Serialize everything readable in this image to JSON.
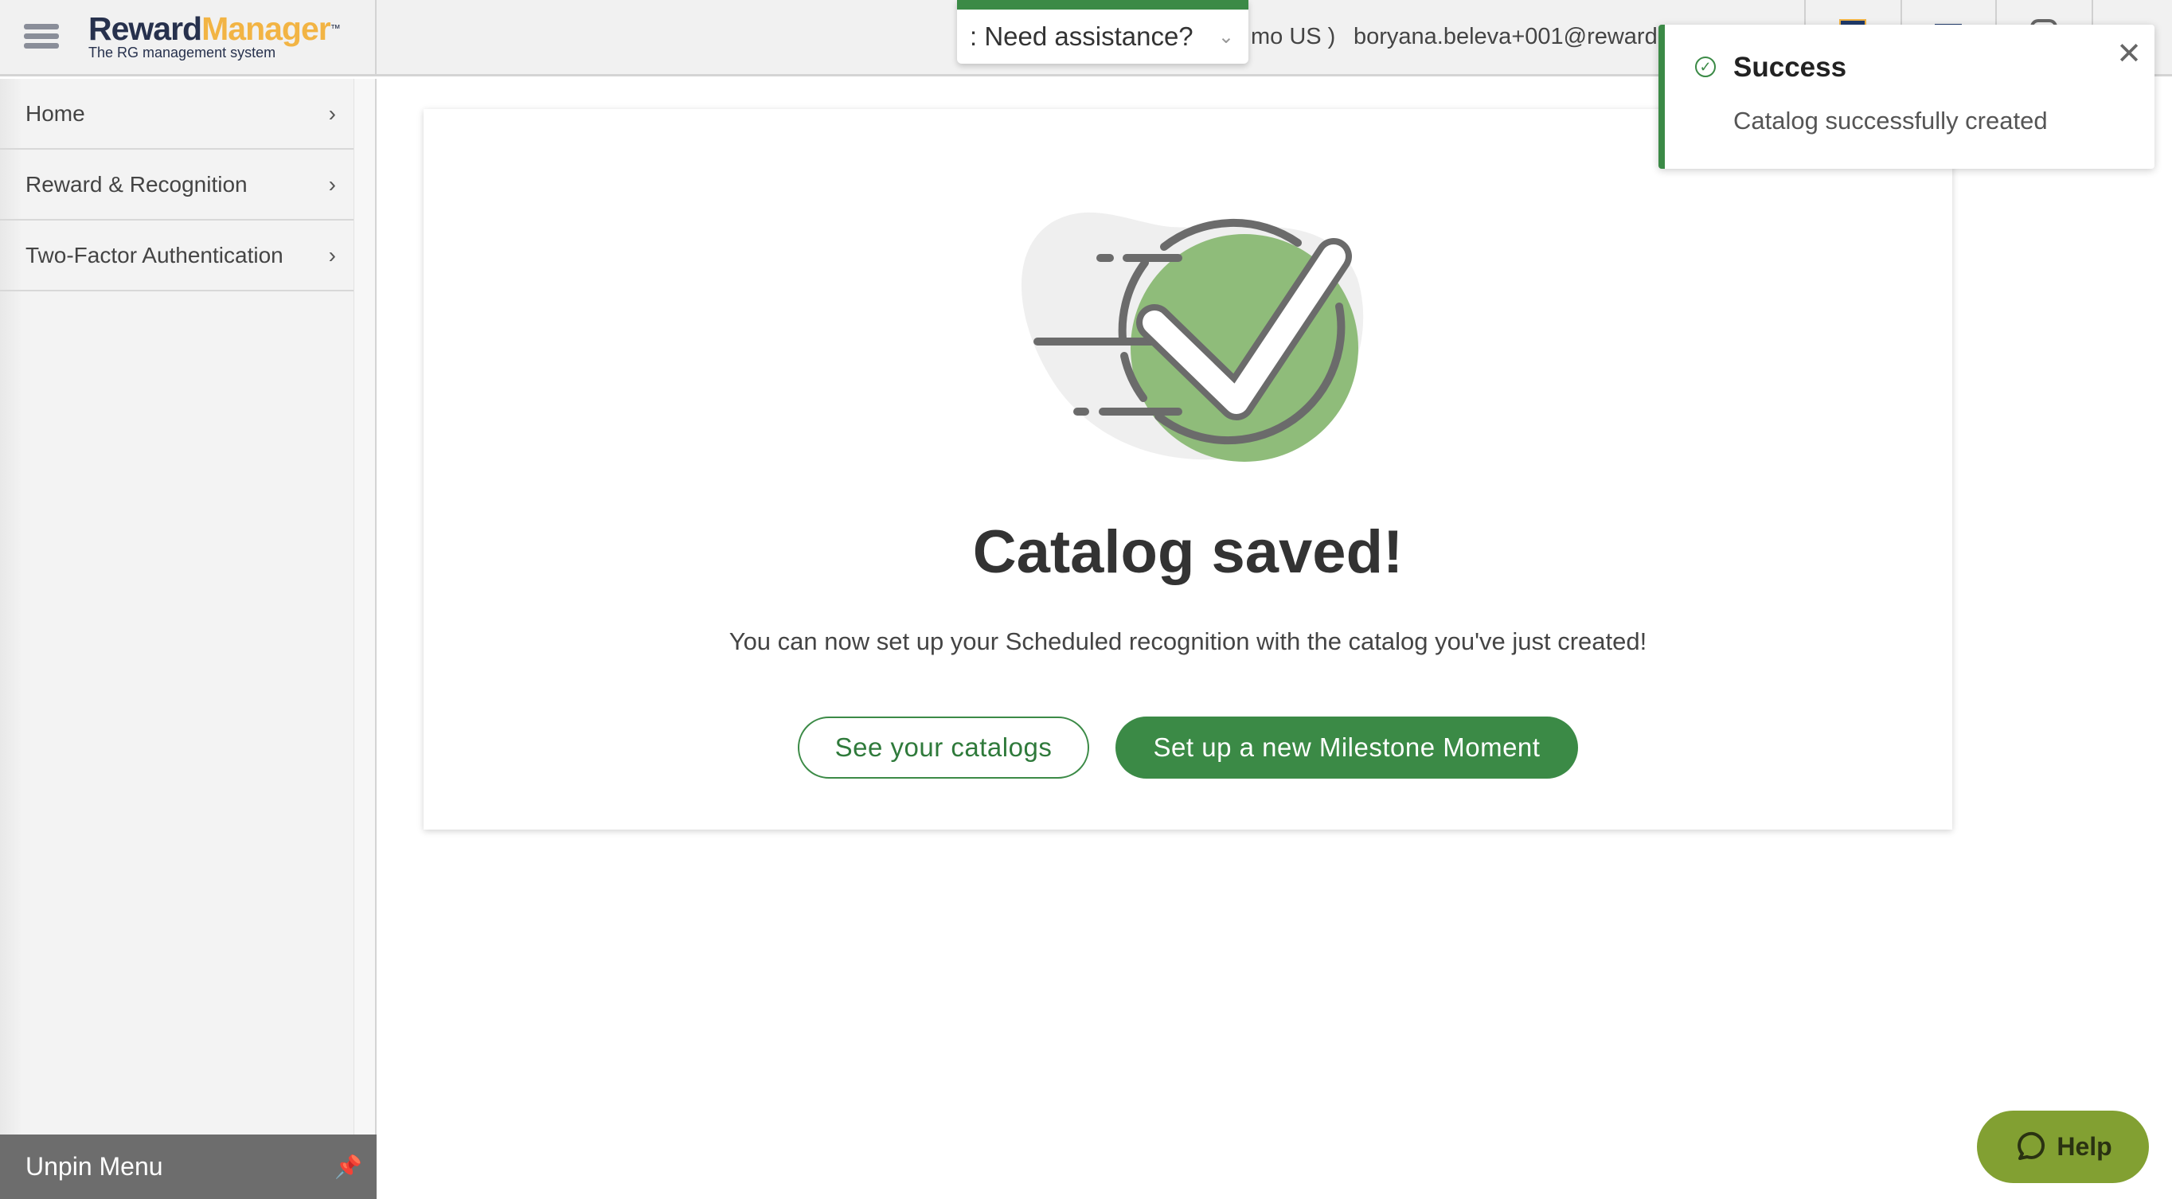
{
  "header": {
    "brand_part1": "Reward",
    "brand_part2": "Manager",
    "brand_tm": "™",
    "tagline": "The RG management system",
    "assistance_label": ": Need assistance?",
    "account_suffix": "mo US )",
    "user_email": "boryana.beleva+001@rewardg"
  },
  "sidebar": {
    "items": [
      {
        "label": "Home"
      },
      {
        "label": "Reward & Recognition"
      },
      {
        "label": "Two-Factor Authentication"
      }
    ],
    "unpin_label": "Unpin Menu"
  },
  "main": {
    "title": "Catalog saved!",
    "subtitle": "You can now set up your Scheduled recognition with the catalog you've just created!",
    "secondary_button": "See your catalogs",
    "primary_button": "Set up a new Milestone Moment"
  },
  "toast": {
    "title": "Success",
    "message": "Catalog successfully created"
  },
  "help_label": "Help",
  "colors": {
    "primary_green": "#3b8a46",
    "illustration_green": "#8fbc7a",
    "brand_navy": "#27314d",
    "brand_orange": "#f2b444",
    "help_green": "#82a032"
  }
}
